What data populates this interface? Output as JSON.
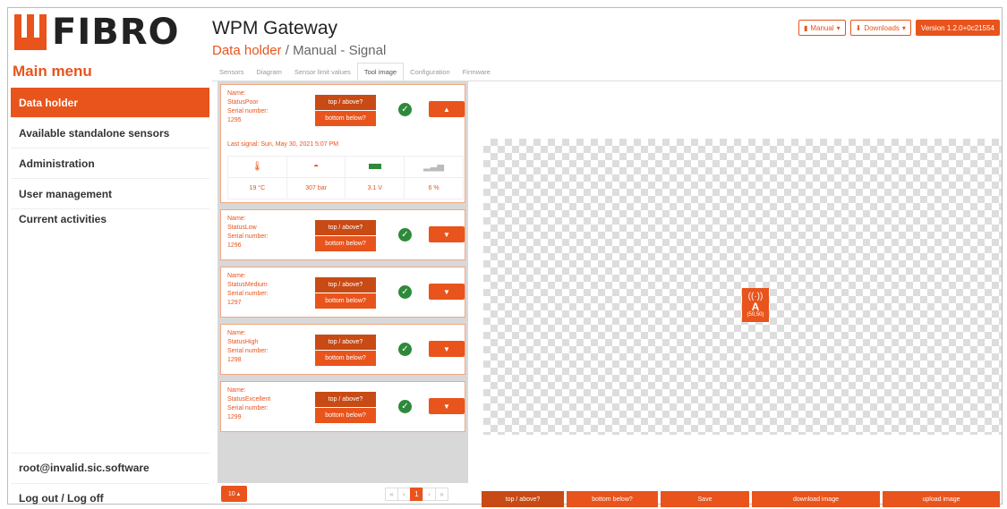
{
  "logo": {
    "text": "FIBRO"
  },
  "header": {
    "title": "WPM Gateway",
    "breadcrumb_link": "Data holder",
    "breadcrumb_rest": " / Manual - Signal",
    "manual_label": "Manual",
    "downloads_label": "Downloads",
    "version_label": "Version 1.2.0+0c21554"
  },
  "sidebar": {
    "title": "Main menu",
    "items": [
      {
        "label": "Data holder"
      },
      {
        "label": "Available standalone sensors"
      },
      {
        "label": "Administration"
      },
      {
        "label": "User management"
      },
      {
        "label": "Current activities"
      }
    ],
    "user": "root@invalid.sic.software",
    "logout": "Log out / Log off"
  },
  "tabs": [
    "Sensors",
    "Diagram",
    "Sensor limit values",
    "Tool image",
    "Configuration",
    "Firmware"
  ],
  "cards": [
    {
      "name_label": "Name:",
      "name": "StatusPoor",
      "serial_label": "Serial number:",
      "serial": "1295",
      "top_label": "top / above?",
      "bottom_label": "bottom below?",
      "last_signal": "Last signal: Sun, May 30, 2021 5:07 PM",
      "sensors": {
        "temp": "19 °C",
        "pressure": "307 bar",
        "battery": "3.1 V",
        "signal": "6 %"
      }
    },
    {
      "name_label": "Name:",
      "name": "StatusLow",
      "serial_label": "Serial number:",
      "serial": "1296",
      "top_label": "top / above?",
      "bottom_label": "bottom below?"
    },
    {
      "name_label": "Name:",
      "name": "StatusMedium",
      "serial_label": "Serial number:",
      "serial": "1297",
      "top_label": "top / above?",
      "bottom_label": "bottom below?"
    },
    {
      "name_label": "Name:",
      "name": "StatusHigh",
      "serial_label": "Serial number:",
      "serial": "1298",
      "top_label": "top / above?",
      "bottom_label": "bottom below?"
    },
    {
      "name_label": "Name:",
      "name": "StatusExcellent",
      "serial_label": "Serial number:",
      "serial": "1299",
      "top_label": "top / above?",
      "bottom_label": "bottom below?"
    }
  ],
  "pagination": {
    "page_size": "10",
    "pages": [
      "«",
      "‹",
      "1",
      "›",
      "»"
    ]
  },
  "canvas": {
    "marker_letter": "A",
    "marker_coord": "(50,50)"
  },
  "bottom_buttons": {
    "top": "top / above?",
    "bottom": "bottom below?",
    "save": "Save",
    "download": "download image",
    "upload": "upload image"
  },
  "colors": {
    "accent": "#e8541c",
    "accent_dark": "#c84a14",
    "ok": "#2e8a3a"
  }
}
